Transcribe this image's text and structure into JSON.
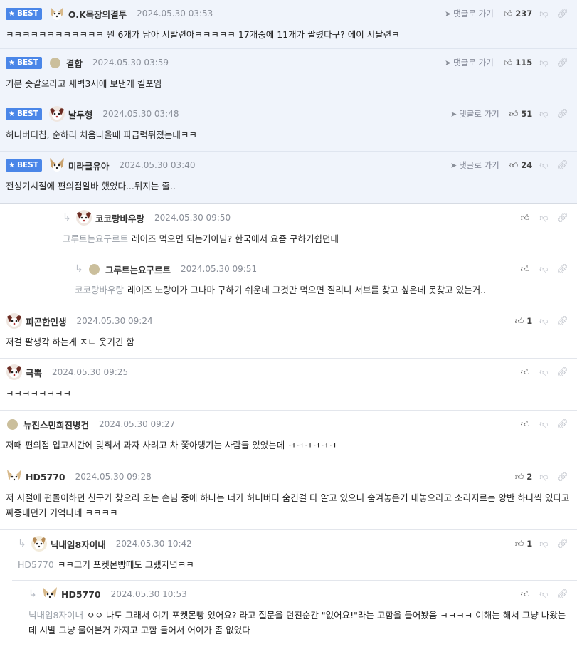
{
  "ui": {
    "best_label": "BEST",
    "goto_label": "댓글로 가기"
  },
  "comments": [
    {
      "nick": "O.K목장의결투",
      "date": "2024.05.30 03:53",
      "text": "ㅋㅋㅋㅋㅋㅋㅋㅋㅋㅋㅋㅋ 뭔 6개가 남아 시발련아ㅋㅋㅋㅋㅋ 17개중에 11개가 팔렸다구? 에이 시팔련ㅋ",
      "likes": "237",
      "best": true
    },
    {
      "nick": "결합",
      "date": "2024.05.30 03:59",
      "text": "기분 좆같으라고 새벽3시에 보낸게 킬포임",
      "likes": "115",
      "best": true
    },
    {
      "nick": "날두형",
      "date": "2024.05.30 03:48",
      "text": "허니버터칩, 순하리 처음나올때 파급력뒤졌는데ㅋㅋ",
      "likes": "51",
      "best": true
    },
    {
      "nick": "미라클유아",
      "date": "2024.05.30 03:40",
      "text": "전성기시절에 편의점알바 했었다...뒤지는 줄..",
      "likes": "24",
      "best": true
    },
    {
      "nick": "코코랑바우랑",
      "date": "2024.05.30 09:50",
      "mention": "그루트는요구르트",
      "text": "레이즈 먹으면 되는거아님? 한국에서 요즘 구하기쉽던데",
      "likes": ""
    },
    {
      "nick": "그루트는요구르트",
      "date": "2024.05.30 09:51",
      "mention": "코코랑바우랑",
      "text": "레이즈 노랑이가 그나마 구하기 쉬운데 그것만 먹으면 질리니 서브를 찾고 싶은데 못찾고 있는거..",
      "likes": ""
    },
    {
      "nick": "피곤한인생",
      "date": "2024.05.30 09:24",
      "text": "저걸 팔생각 하는게 ㅈㄴ 웃기긴 함",
      "likes": "1"
    },
    {
      "nick": "극뽁",
      "date": "2024.05.30 09:25",
      "text": "ㅋㅋㅋㅋㅋㅋㅋㅋ",
      "likes": ""
    },
    {
      "nick": "뉴진스민희진병건",
      "date": "2024.05.30 09:27",
      "text": "저때 편의점 입고시간에 맞춰서 과자 사려고 차 쫓아댕기는 사람들 있었는데 ㅋㅋㅋㅋㅋㅋ",
      "likes": ""
    },
    {
      "nick": "HD5770",
      "date": "2024.05.30 09:28",
      "text": "저 시절에 편돌이하던 친구가 찾으러 오는 손님 중에 하나는 너가 허니버터 숨긴걸 다 알고 있으니 숨겨놓은거 내놓으라고 소리지르는 양반 하나씩 있다고 짜증내던거 기억나네 ㅋㅋㅋㅋ",
      "likes": "2"
    },
    {
      "nick": "닉내임8자이내",
      "date": "2024.05.30 10:42",
      "mention": "HD5770",
      "text": "ㅋㅋ그거 포켓몬빵때도 그랬자넠ㅋㅋ",
      "likes": "1"
    },
    {
      "nick": "HD5770",
      "date": "2024.05.30 10:53",
      "mention": "닉내임8자이내",
      "text": "ㅇㅇ 나도 그래서 여기 포켓몬빵 있어요? 라고 질문을 던진순간 \"없어요!\"라는 고함을 들어봤음 ㅋㅋㅋㅋ 이해는 해서 그냥 나왔는데 시발 그냥 물어본거 가지고 고함 들어서 어이가 좀 없었다",
      "likes": ""
    }
  ]
}
